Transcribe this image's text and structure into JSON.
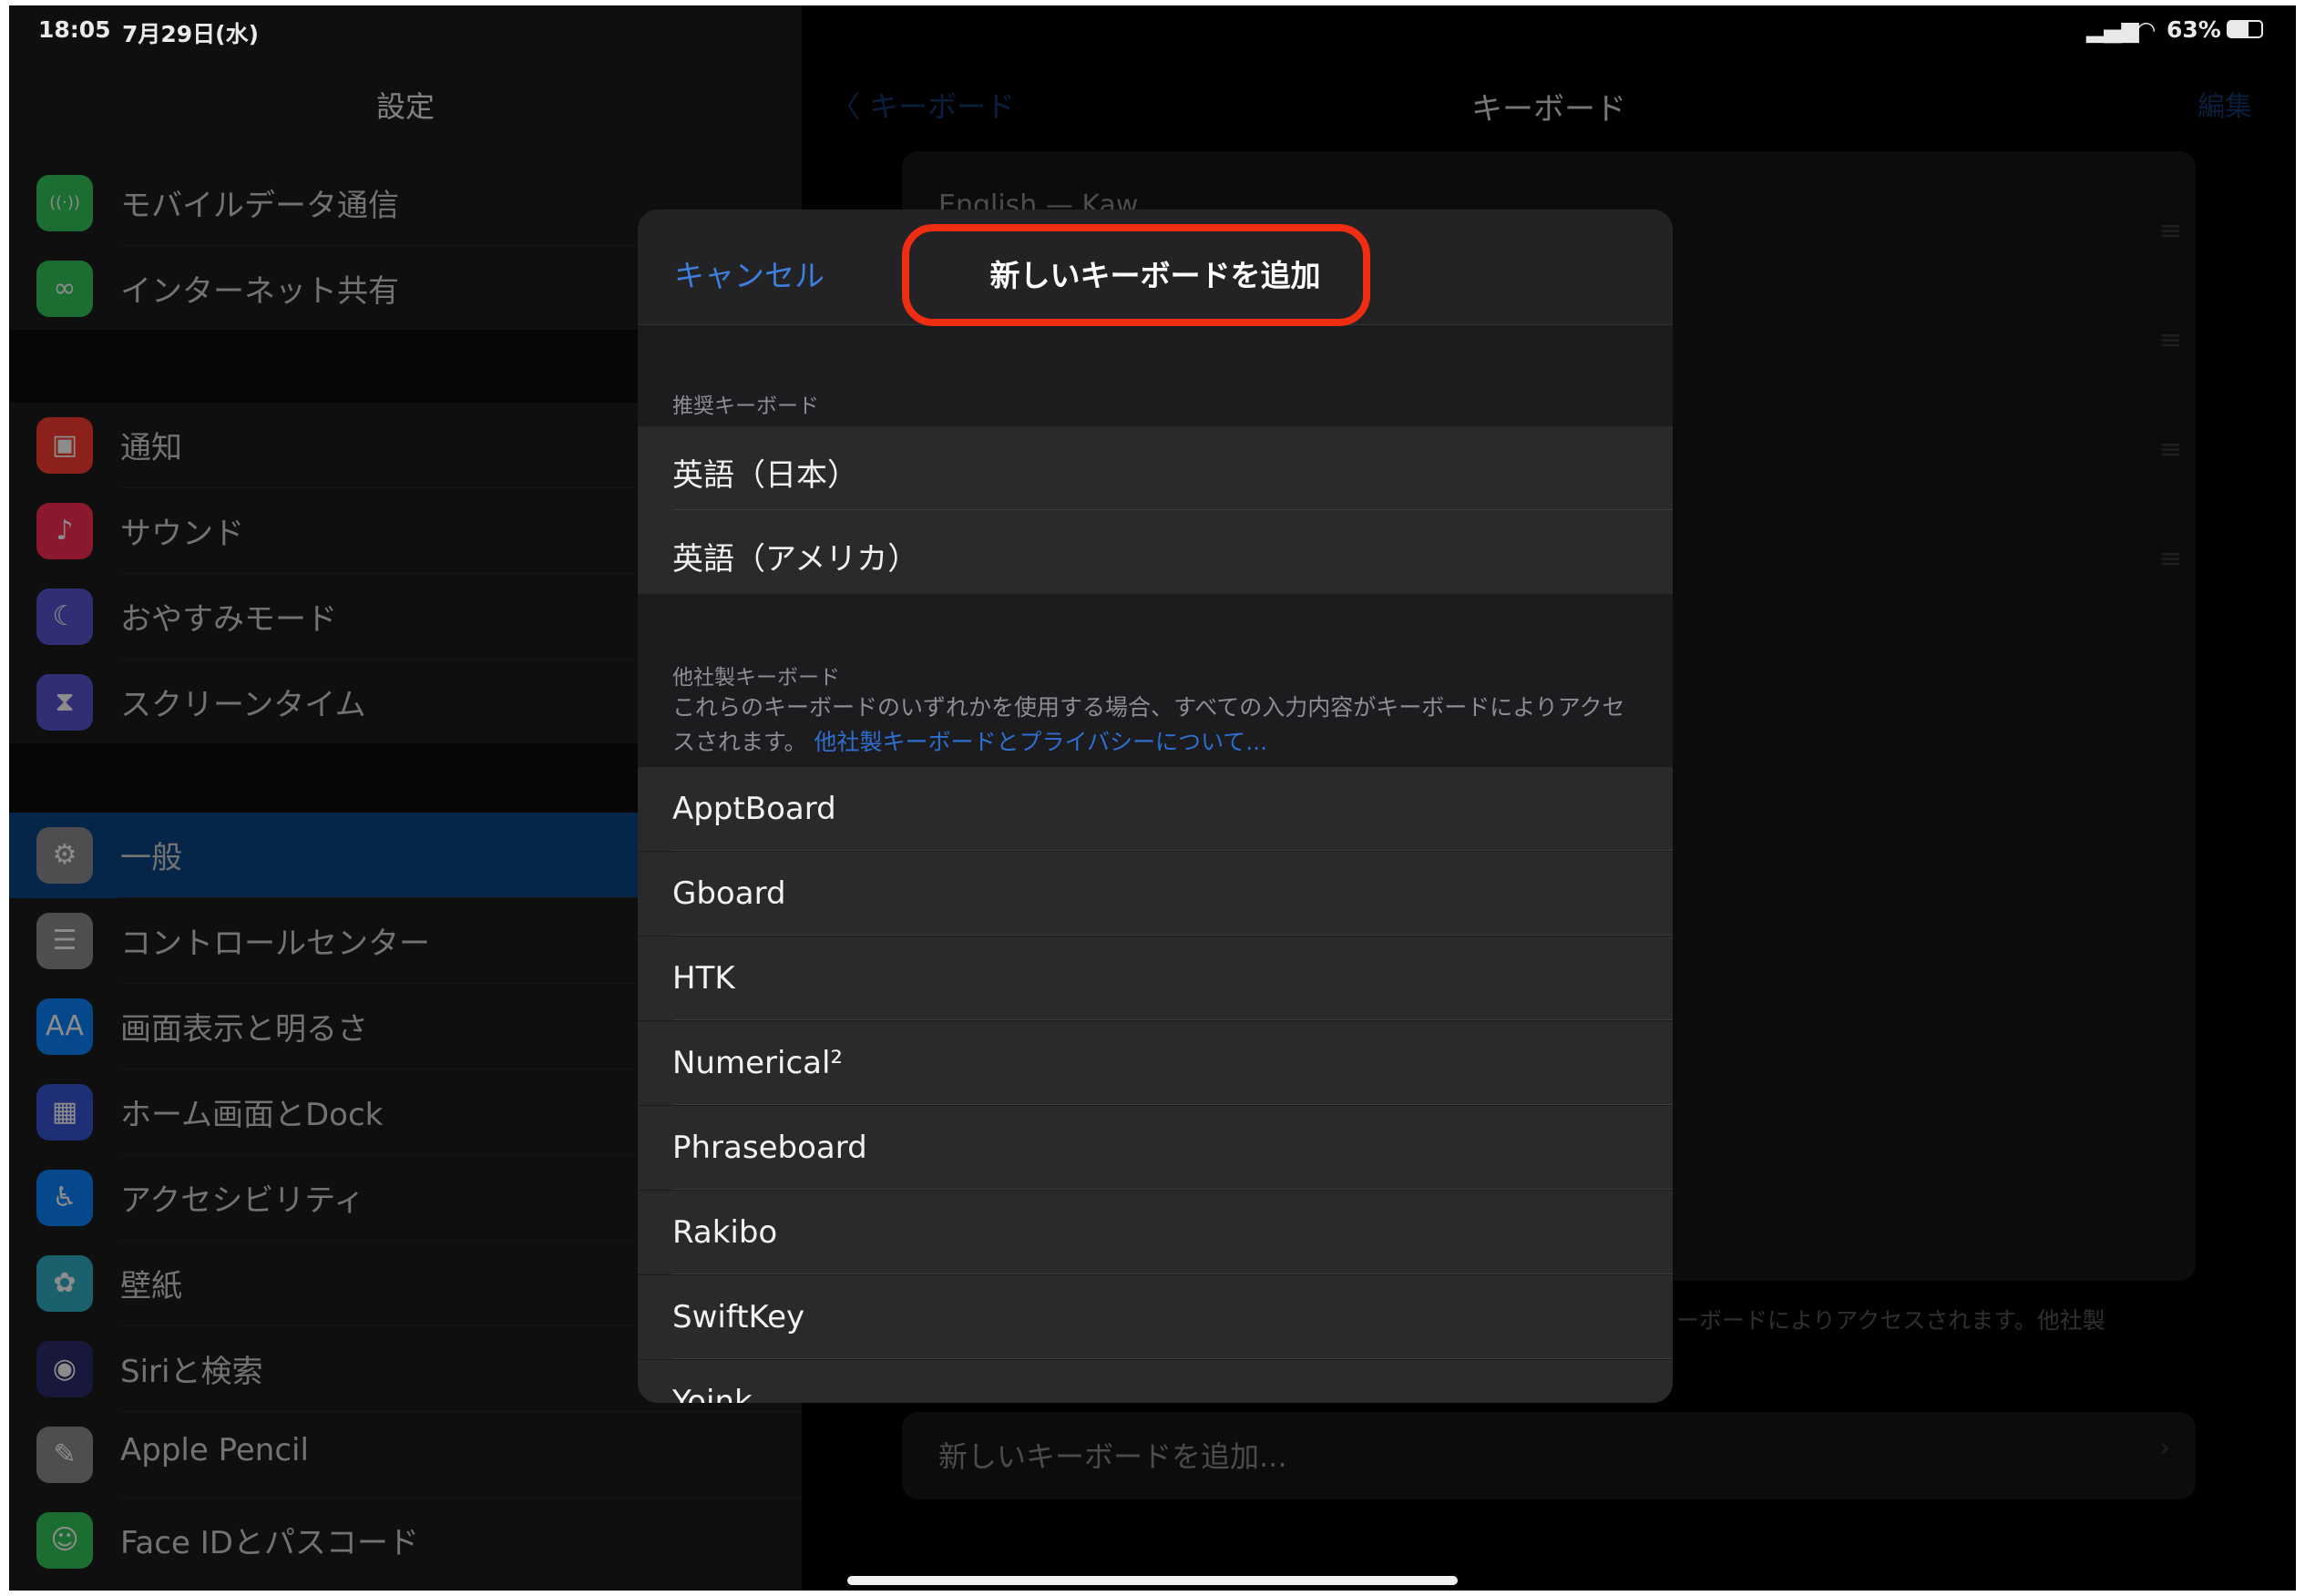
{
  "status_bar": {
    "time": "18:05",
    "date": "7月29日(水)",
    "battery": "63%"
  },
  "sidebar": {
    "title": "設定",
    "items": [
      {
        "label": "モバイルデータ通信",
        "icon": "antenna-icon",
        "color": "#34c759",
        "glyph": "((·))"
      },
      {
        "label": "インターネット共有",
        "icon": "link-icon",
        "color": "#34c759",
        "glyph": "∞"
      },
      {
        "label": "通知",
        "icon": "notification-icon",
        "color": "#ff3b30",
        "glyph": "▣"
      },
      {
        "label": "サウンド",
        "icon": "speaker-icon",
        "color": "#ff2d55",
        "glyph": "♪"
      },
      {
        "label": "おやすみモード",
        "icon": "moon-icon",
        "color": "#5856d6",
        "glyph": "☾"
      },
      {
        "label": "スクリーンタイム",
        "icon": "hourglass-icon",
        "color": "#5856d6",
        "glyph": "⧗"
      },
      {
        "label": "一般",
        "icon": "gear-icon",
        "color": "#8e8e93",
        "glyph": "⚙"
      },
      {
        "label": "コントロールセンター",
        "icon": "switches-icon",
        "color": "#8e8e93",
        "glyph": "☰"
      },
      {
        "label": "画面表示と明るさ",
        "icon": "text-size-icon",
        "color": "#0a84ff",
        "glyph": "AA"
      },
      {
        "label": "ホーム画面とDock",
        "icon": "grid-icon",
        "color": "#3a57d8",
        "glyph": "▦"
      },
      {
        "label": "アクセシビリティ",
        "icon": "accessibility-icon",
        "color": "#0a84ff",
        "glyph": "♿"
      },
      {
        "label": "壁紙",
        "icon": "flower-icon",
        "color": "#30b0c7",
        "glyph": "✿"
      },
      {
        "label": "Siriと検索",
        "icon": "siri-icon",
        "color": "#2c2c6e",
        "glyph": "◉"
      },
      {
        "label": "Apple Pencil",
        "icon": "pencil-icon",
        "color": "#8e8e93",
        "glyph": "✎"
      },
      {
        "label": "Face IDとパスコード",
        "icon": "face-id-icon",
        "color": "#34c759",
        "glyph": "☺"
      }
    ]
  },
  "detail": {
    "back_label": "〈 キーボード",
    "title": "キーボード",
    "edit_label": "編集",
    "peek_text": "English — Kaw...",
    "footer_text": "ーボードによりアクセスされます。他社製",
    "add_label": "新しいキーボードを追加..."
  },
  "modal": {
    "cancel_label": "キャンセル",
    "title": "新しいキーボードを追加",
    "suggested_header": "推奨キーボード",
    "suggested": [
      "英語（日本）",
      "英語（アメリカ）"
    ],
    "third_party_header": "他社製キーボード",
    "third_party_note": "これらのキーボードのいずれかを使用する場合、すべての入力内容がキーボードによりアクセスされます。",
    "third_party_link": "他社製キーボードとプライバシーについて...",
    "third_party": [
      "ApptBoard",
      "Gboard",
      "HTK",
      "Numerical²",
      "Phraseboard",
      "Rakibo",
      "SwiftKey",
      "Yoink"
    ],
    "highlight_color": "#ef2d12"
  }
}
